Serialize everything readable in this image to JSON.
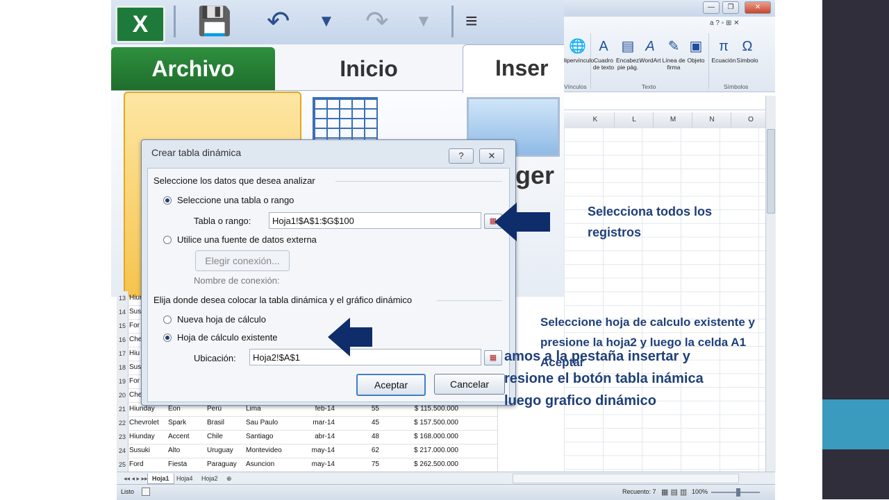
{
  "zoomed_ribbon": {
    "tab_archivo": "Archivo",
    "tab_inicio": "Inicio",
    "tab_insertar": "Inser",
    "partial_text": "ger"
  },
  "ribbon": {
    "controls_right": "a ? ▫ ⊞ ✕",
    "hyperlink_label": "Hipervínculo",
    "links_group": "Vínculos",
    "buttons": [
      {
        "label": "Cuadro de texto",
        "icon": "text-box-icon"
      },
      {
        "label": "Encabez. pie pág.",
        "icon": "header-footer-icon"
      },
      {
        "label": "WordArt",
        "icon": "wordart-icon"
      },
      {
        "label": "Línea de firma",
        "icon": "signature-line-icon"
      },
      {
        "label": "Objeto",
        "icon": "object-icon"
      },
      {
        "label": "Ecuación",
        "icon": "equation-icon"
      },
      {
        "label": "Símbolo",
        "icon": "symbol-icon"
      }
    ],
    "group_texto": "Texto",
    "group_simbolos": "Símbolos"
  },
  "columns": [
    "K",
    "L",
    "M",
    "N",
    "O"
  ],
  "rows": [
    {
      "n": "13",
      "c": [
        "Hiun",
        "",
        "",
        "",
        "",
        "",
        ""
      ]
    },
    {
      "n": "14",
      "c": [
        "Sus",
        "",
        "",
        "",
        "",
        "",
        ""
      ]
    },
    {
      "n": "15",
      "c": [
        "For",
        "",
        "",
        "",
        "",
        "",
        ""
      ]
    },
    {
      "n": "16",
      "c": [
        "Che",
        "",
        "",
        "",
        "",
        "",
        ""
      ]
    },
    {
      "n": "17",
      "c": [
        "Hiu",
        "",
        "",
        "",
        "",
        "",
        ""
      ]
    },
    {
      "n": "18",
      "c": [
        "Sus",
        "",
        "",
        "",
        "",
        "",
        ""
      ]
    },
    {
      "n": "19",
      "c": [
        "For",
        "",
        "",
        "",
        "",
        "",
        ""
      ]
    },
    {
      "n": "20",
      "c": [
        "Che",
        "",
        "",
        "",
        "",
        "",
        ""
      ]
    },
    {
      "n": "21",
      "c": [
        "Hiunday",
        "Eon",
        "Perú",
        "Lima",
        "feb-14",
        "55",
        "$ 115.500.000"
      ]
    },
    {
      "n": "22",
      "c": [
        "Chevrolet",
        "Spark",
        "Brasil",
        "Sau Paulo",
        "mar-14",
        "45",
        "$ 157.500.000"
      ]
    },
    {
      "n": "23",
      "c": [
        "Hiunday",
        "Accent",
        "Chile",
        "Santiago",
        "abr-14",
        "48",
        "$ 168.000.000"
      ]
    },
    {
      "n": "24",
      "c": [
        "Susuki",
        "Alto",
        "Uruguay",
        "Montevideo",
        "may-14",
        "62",
        "$ 217.000.000"
      ]
    },
    {
      "n": "25",
      "c": [
        "Ford",
        "Fiesta",
        "Paraguay",
        "Asuncion",
        "may-14",
        "75",
        "$ 262.500.000"
      ]
    }
  ],
  "sheet_tabs": [
    "Hoja1",
    "Hoja4",
    "Hoja2"
  ],
  "status": {
    "ready": "Listo",
    "count": "Recuento: 7",
    "zoom": "100%"
  },
  "dialog": {
    "title": "Crear tabla dinámica",
    "help": "?",
    "close": "✕",
    "section1": "Seleccione los datos que desea analizar",
    "opt_table": "Seleccione una tabla o rango",
    "range_label": "Tabla o rango:",
    "range_value": "Hoja1!$A$1:$G$100",
    "opt_external": "Utilice una fuente de datos externa",
    "choose_conn": "Elegir conexión...",
    "conn_name": "Nombre de conexión:",
    "section2": "Elija donde desea colocar la tabla dinámica y el gráfico dinámico",
    "opt_new": "Nueva hoja de cálculo",
    "opt_existing": "Hoja de cálculo existente",
    "location_label": "Ubicación:",
    "location_value": "Hoja2!$A$1",
    "ok": "Aceptar",
    "cancel": "Cancelar"
  },
  "notes": {
    "note1": "Selecciona todos los registros",
    "note2": "Seleccione hoja de calculo existente y presione la hoja2 y luego la celda A1 Aceptar",
    "note3": "amos a la pestaña insertar y resione el botón tabla inámica luego grafico dinámico"
  },
  "colors": {
    "arrow": "#0f2d6b",
    "annotation": "#1f3f79",
    "side_dark": "#2f2e3a",
    "side_teal": "#3a9bbf"
  }
}
